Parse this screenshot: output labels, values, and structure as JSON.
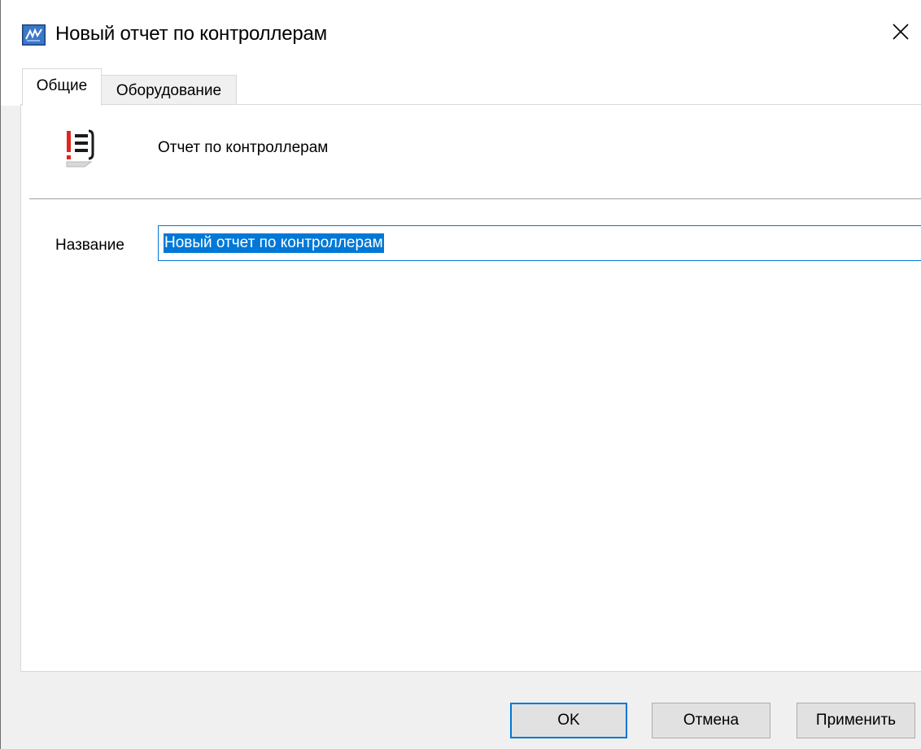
{
  "window": {
    "title": "Новый отчет по контроллерам",
    "app_icon": "app-logo-icon",
    "close_icon": "close-icon"
  },
  "tabs": [
    {
      "label": "Общие",
      "active": true
    },
    {
      "label": "Оборудование",
      "active": false
    }
  ],
  "general": {
    "report_icon": "report-list-icon",
    "report_type": "Отчет по контроллерам",
    "name_label": "Название",
    "name_value": "Новый отчет по контроллерам"
  },
  "buttons": {
    "ok_label": "OK",
    "cancel_label": "Отмена",
    "apply_label": "Применить"
  },
  "colors": {
    "accent": "#0078d7",
    "report_icon_red": "#e0261f"
  }
}
